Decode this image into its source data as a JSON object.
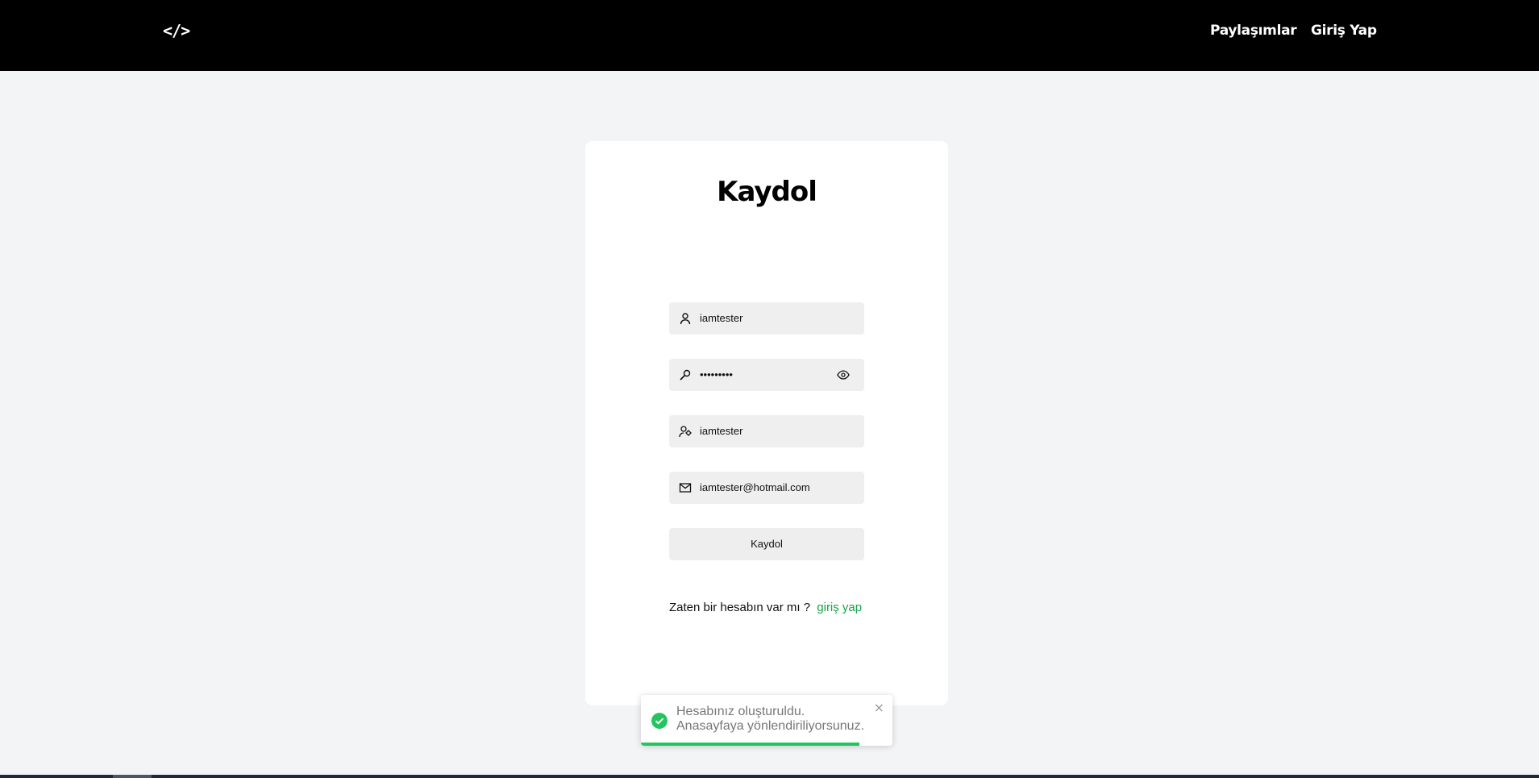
{
  "navbar": {
    "logo_text": "</>",
    "links": [
      {
        "label": "Paylaşımlar"
      },
      {
        "label": "Giriş Yap"
      }
    ]
  },
  "form": {
    "title": "Kaydol",
    "fields": [
      {
        "icon": "user-icon",
        "value": "iamtester"
      },
      {
        "icon": "key-icon",
        "value": "•••••••••",
        "toggle_icon": "eye-icon"
      },
      {
        "icon": "user-tag-icon",
        "value": "iamtester"
      },
      {
        "icon": "mail-icon",
        "value": "iamtester@hotmail.com"
      }
    ],
    "submit_label": "Kaydol",
    "account_prompt": "Zaten bir hesabın var mı ?",
    "account_link": "giriş yap"
  },
  "toast": {
    "icon": "check-circle-icon",
    "line1": "Hesabınız oluşturuldu.",
    "line2": "Anasayfaya yönlendiriliyorsunuz.",
    "close_icon": "close-icon",
    "progress": 0.87
  },
  "colors": {
    "navbar_bg": "#000000",
    "page_bg": "#f3f4f6",
    "link_green": "#16a34a",
    "success_green": "#22c55e"
  }
}
